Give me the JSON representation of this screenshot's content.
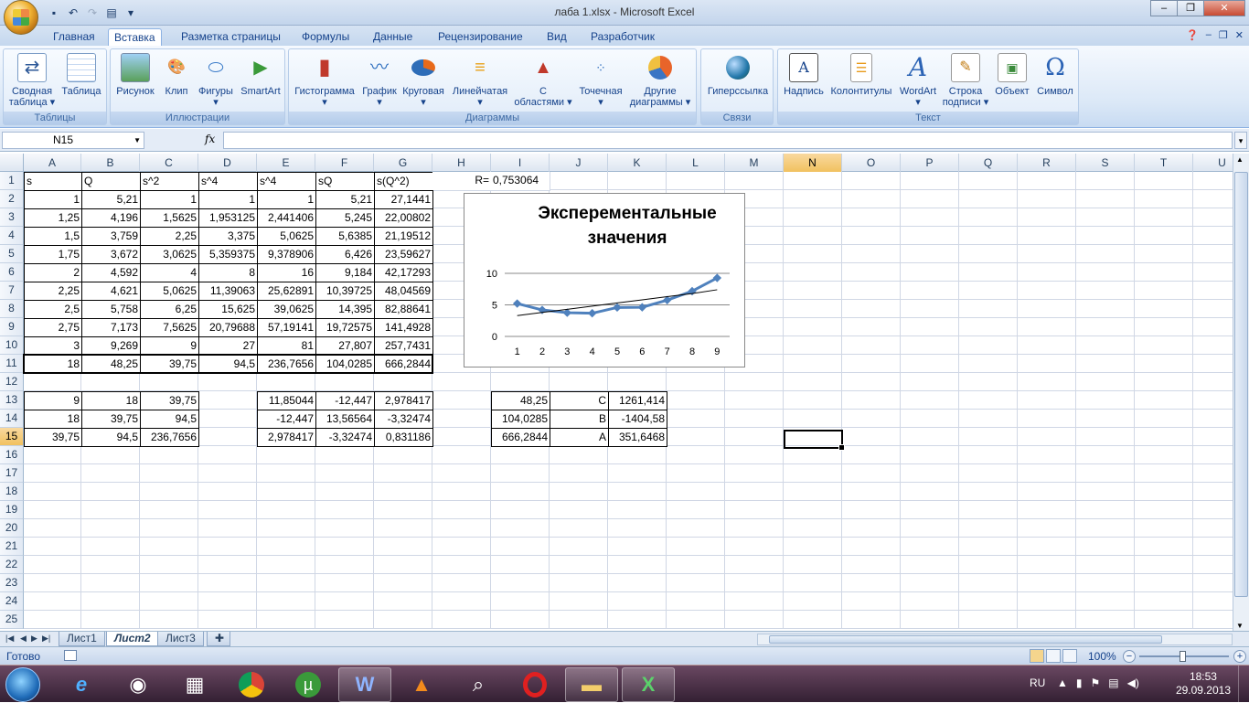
{
  "window": {
    "title": "лаба 1.xlsx - Microsoft Excel",
    "controls": [
      "‒",
      "❐",
      "✕"
    ]
  },
  "ribbon_tabs": [
    "Главная",
    "Вставка",
    "Разметка страницы",
    "Формулы",
    "Данные",
    "Рецензирование",
    "Вид",
    "Разработчик"
  ],
  "active_tab": "Вставка",
  "ribbon_groups": {
    "tables": {
      "label": "Таблицы",
      "buttons": [
        "Сводная\nтаблица ▾",
        "Таблица"
      ]
    },
    "illustrations": {
      "label": "Иллюстрации",
      "buttons": [
        "Рисунок",
        "Клип",
        "Фигуры\n▾",
        "SmartArt"
      ]
    },
    "charts": {
      "label": "Диаграммы",
      "buttons": [
        "Гистограмма\n▾",
        "График\n▾",
        "Круговая\n▾",
        "Линейчатая\n▾",
        "С\nобластями ▾",
        "Точечная\n▾",
        "Другие\nдиаграммы ▾"
      ]
    },
    "links": {
      "label": "Связи",
      "buttons": [
        "Гиперссылка"
      ]
    },
    "text": {
      "label": "Текст",
      "buttons": [
        "Надпись",
        "Колонтитулы",
        "WordArt\n▾",
        "Строка\nподписи ▾",
        "Объект",
        "Символ"
      ]
    }
  },
  "formula_bar": {
    "name_box": "N15",
    "fx_label": "fx",
    "formula": ""
  },
  "columns": [
    "A",
    "B",
    "C",
    "D",
    "E",
    "F",
    "G",
    "H",
    "I",
    "J",
    "K",
    "L",
    "M",
    "N",
    "O",
    "P",
    "Q",
    "R",
    "S",
    "T",
    "U"
  ],
  "selected_column": "N",
  "selected_row": 15,
  "rows": [
    1,
    2,
    3,
    4,
    5,
    6,
    7,
    8,
    9,
    10,
    11,
    12,
    13,
    14,
    15,
    16,
    17,
    18,
    19,
    20,
    21,
    22,
    23,
    24,
    25
  ],
  "cells": {
    "r1": [
      "s",
      "Q",
      "s^2",
      "s^4",
      "s^4",
      "sQ",
      "s(Q^2)",
      "R=",
      "0,753064"
    ],
    "r2": [
      "1",
      "5,21",
      "1",
      "1",
      "1",
      "5,21",
      "27,1441"
    ],
    "r3": [
      "1,25",
      "4,196",
      "1,5625",
      "1,953125",
      "2,441406",
      "5,245",
      "22,00802"
    ],
    "r4": [
      "1,5",
      "3,759",
      "2,25",
      "3,375",
      "5,0625",
      "5,6385",
      "21,19512"
    ],
    "r5": [
      "1,75",
      "3,672",
      "3,0625",
      "5,359375",
      "9,378906",
      "6,426",
      "23,59627"
    ],
    "r6": [
      "2",
      "4,592",
      "4",
      "8",
      "16",
      "9,184",
      "42,17293"
    ],
    "r7": [
      "2,25",
      "4,621",
      "5,0625",
      "11,39063",
      "25,62891",
      "10,39725",
      "48,04569"
    ],
    "r8": [
      "2,5",
      "5,758",
      "6,25",
      "15,625",
      "39,0625",
      "14,395",
      "82,88641"
    ],
    "r9": [
      "2,75",
      "7,173",
      "7,5625",
      "20,79688",
      "57,19141",
      "19,72575",
      "141,4928"
    ],
    "r10": [
      "3",
      "9,269",
      "9",
      "27",
      "81",
      "27,807",
      "257,7431"
    ],
    "r11": [
      "18",
      "48,25",
      "39,75",
      "94,5",
      "236,7656",
      "104,0285",
      "666,2844"
    ],
    "r13": [
      "9",
      "18",
      "39,75",
      "11,85044",
      "-12,447",
      "2,978417",
      "48,25",
      "C",
      "1261,414"
    ],
    "r14": [
      "18",
      "39,75",
      "94,5",
      "-12,447",
      "13,56564",
      "-3,32474",
      "104,0285",
      "B",
      "-1404,58"
    ],
    "r15": [
      "39,75",
      "94,5",
      "236,7656",
      "2,978417",
      "-3,32474",
      "0,831186",
      "666,2844",
      "A",
      "351,6468"
    ]
  },
  "chart": {
    "title_line1": "Эксперементальные",
    "title_line2": "значения"
  },
  "chart_data": {
    "type": "line",
    "title": "Эксперементальные значения",
    "categories": [
      "1",
      "2",
      "3",
      "4",
      "5",
      "6",
      "7",
      "8",
      "9"
    ],
    "series": [
      {
        "values": [
          5.21,
          4.196,
          3.759,
          3.672,
          4.592,
          4.621,
          5.758,
          7.173,
          9.269
        ],
        "color": "#4f81bd",
        "marker": "diamond"
      },
      {
        "values": [
          3.3,
          3.8,
          4.3,
          4.8,
          5.3,
          5.8,
          6.3,
          6.8,
          7.4
        ],
        "color": "#000000",
        "marker": "none",
        "trendline": true
      }
    ],
    "y_ticks": [
      "0",
      "5",
      "10"
    ],
    "ylim": [
      0,
      10
    ],
    "grid": "horizontal",
    "legend": "none"
  },
  "sheets": [
    "Лист1",
    "Лист2",
    "Лист3"
  ],
  "active_sheet": "Лист2",
  "status": {
    "ready": "Готово",
    "zoom": "100%"
  },
  "taskbar": {
    "apps": [
      "internet-explorer",
      "user",
      "calculator",
      "chrome",
      "utorrent",
      "word",
      "vlc",
      "search",
      "opera",
      "explorer",
      "excel"
    ],
    "language": "RU",
    "time": "18:53",
    "date": "29.09.2013"
  }
}
